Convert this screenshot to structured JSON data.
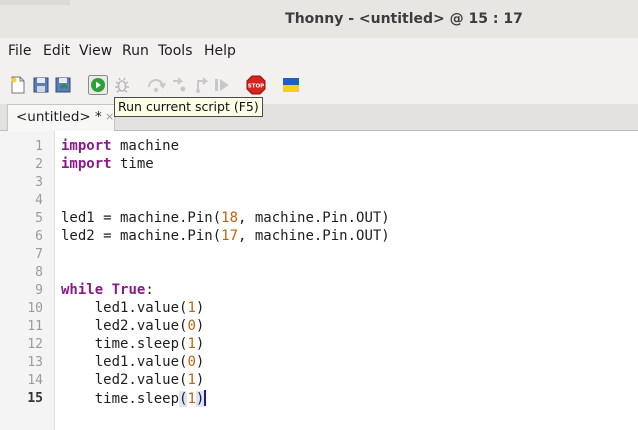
{
  "window": {
    "title": "Thonny  -  <untitled>  @  15 : 17"
  },
  "menu": [
    "File",
    "Edit",
    "View",
    "Run",
    "Tools",
    "Help"
  ],
  "toolbar": {
    "buttons": [
      "new-file",
      "open-file",
      "save-file",
      "run",
      "debug",
      "step-over",
      "step-into",
      "step-out",
      "resume",
      "stop",
      "ukraine-flag"
    ]
  },
  "tooltip": {
    "text": "Run current script (F5)"
  },
  "tabs": [
    {
      "label": "<untitled> *",
      "close": "×"
    }
  ],
  "editor": {
    "line_numbers": [
      "1",
      "2",
      "3",
      "4",
      "5",
      "6",
      "7",
      "8",
      "9",
      "10",
      "11",
      "12",
      "13",
      "14",
      "15"
    ],
    "current_line": "15",
    "tokens": {
      "l1_kw": "import",
      "l1_rest": " machine",
      "l2_kw": "import",
      "l2_rest": " time",
      "l5_a": "led1 = machine.Pin(",
      "l5_num": "18",
      "l5_b": ", machine.Pin.OUT)",
      "l6_a": "led2 = machine.Pin(",
      "l6_num": "17",
      "l6_b": ", machine.Pin.OUT)",
      "l9_kw": "while",
      "l9_sp": " ",
      "l9_kw2": "True",
      "l9_rest": ":",
      "l10_a": "    led1.value(",
      "l10_num": "1",
      "l10_b": ")",
      "l11_a": "    led2.value(",
      "l11_num": "0",
      "l11_b": ")",
      "l12_a": "    time.sleep(",
      "l12_num": "1",
      "l12_b": ")",
      "l13_a": "    led1.value(",
      "l13_num": "0",
      "l13_b": ")",
      "l14_a": "    led2.value(",
      "l14_num": "1",
      "l14_b": ")",
      "l15_a": "    time.sleep",
      "l15_paren": "(",
      "l15_num": "1",
      "l15_b": ")"
    }
  },
  "colors": {
    "keyword": "#8a1a8a",
    "number": "#c2620f",
    "run_green": "#2e9e3a",
    "stop_red": "#d8231e"
  }
}
